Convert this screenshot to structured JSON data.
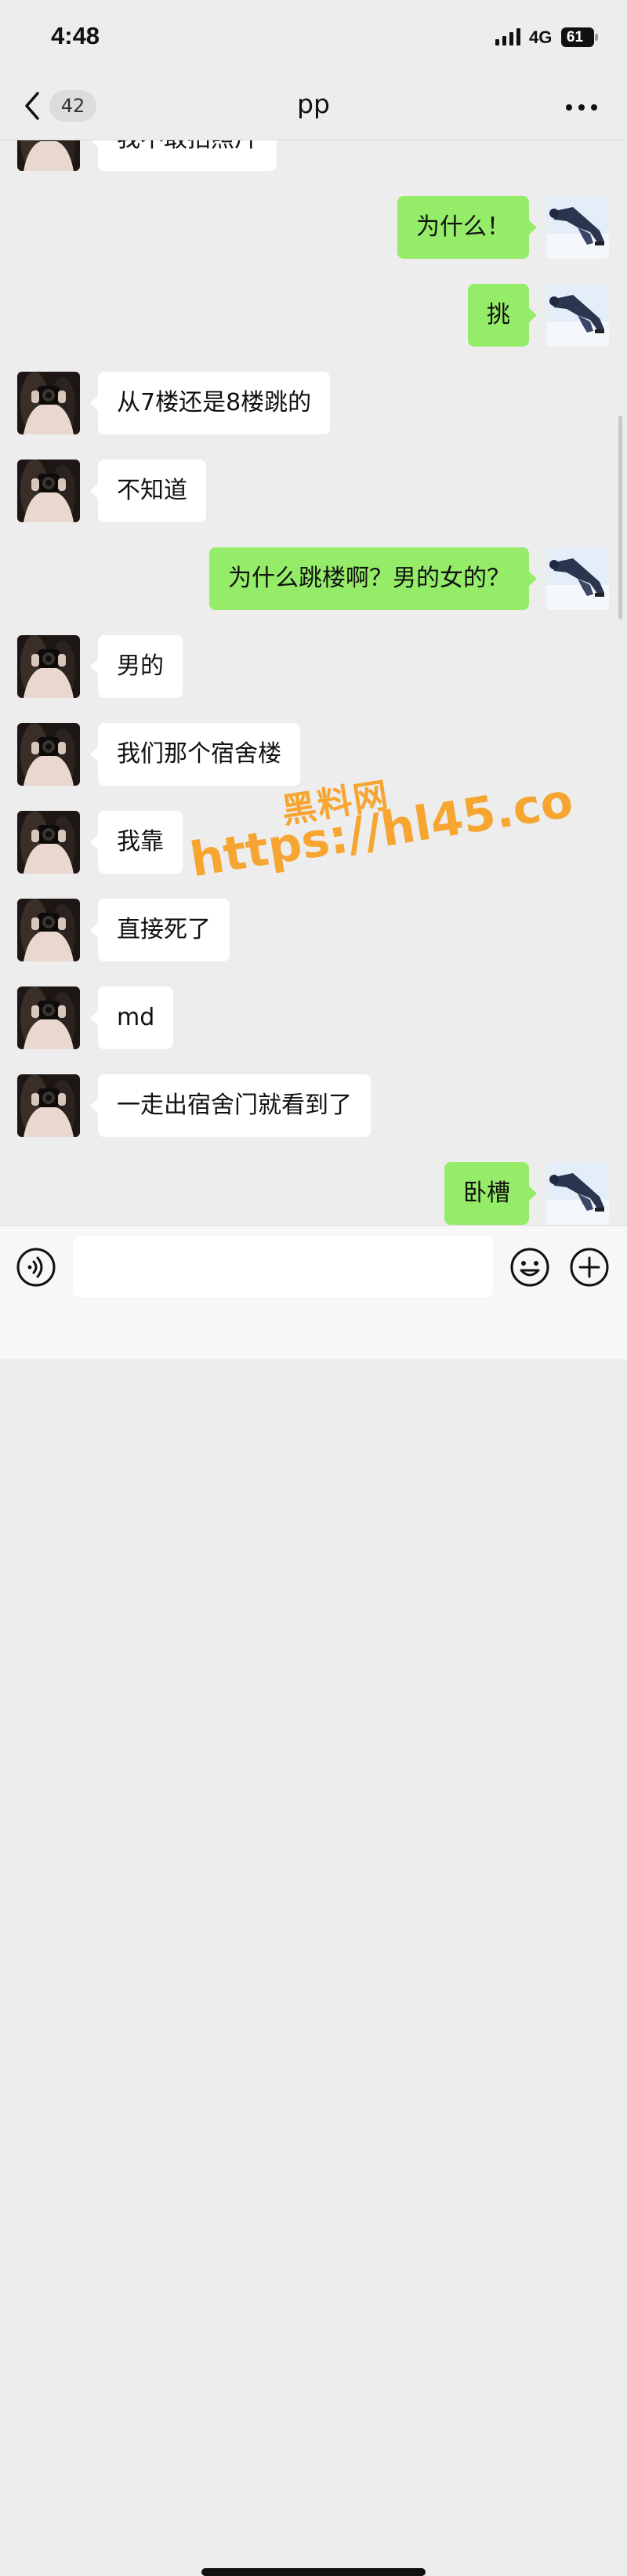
{
  "status_bar": {
    "time": "4:48",
    "network": "4G",
    "battery": "61"
  },
  "nav": {
    "unread_count": "42",
    "title": "pp",
    "back_icon": "chevron-left-icon",
    "more_icon": "more-dots-icon"
  },
  "messages": [
    {
      "side": "left",
      "text": "我不敢拍照片"
    },
    {
      "side": "right",
      "text": "为什么！"
    },
    {
      "side": "right",
      "text": "挑"
    },
    {
      "side": "left",
      "text": "从7楼还是8楼跳的"
    },
    {
      "side": "left",
      "text": "不知道"
    },
    {
      "side": "right",
      "text": "为什么跳楼啊？男的女的？"
    },
    {
      "side": "left",
      "text": "男的"
    },
    {
      "side": "left",
      "text": "我们那个宿舍楼"
    },
    {
      "side": "left",
      "text": "我靠"
    },
    {
      "side": "left",
      "text": "直接死了"
    },
    {
      "side": "left",
      "text": "md"
    },
    {
      "side": "left",
      "text": "一走出宿舍门就看到了"
    },
    {
      "side": "right",
      "text": "卧槽"
    }
  ],
  "watermark": {
    "line1": "黑料网",
    "line2": "https://hl45.co"
  },
  "input_bar": {
    "placeholder": "",
    "voice_icon": "voice-icon",
    "emoji_icon": "emoji-icon",
    "plus_icon": "plus-icon"
  },
  "colors": {
    "background": "#ededed",
    "sent_bubble": "#95ec69",
    "received_bubble": "#ffffff",
    "watermark": "#f6a531"
  }
}
